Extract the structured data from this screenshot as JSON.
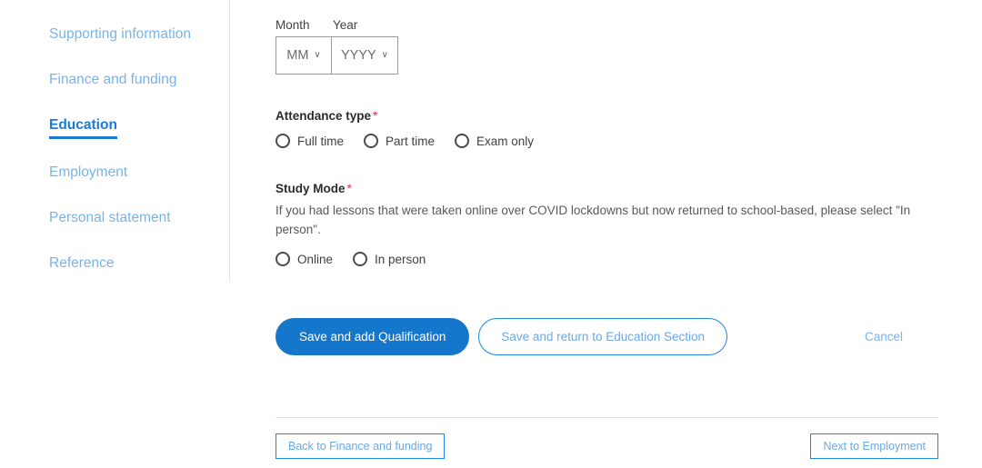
{
  "sidebar": {
    "items": [
      {
        "label": "Supporting information",
        "active": false
      },
      {
        "label": "Finance and funding",
        "active": false
      },
      {
        "label": "Education",
        "active": true
      },
      {
        "label": "Employment",
        "active": false
      },
      {
        "label": "Personal statement",
        "active": false
      },
      {
        "label": "Reference",
        "active": false
      }
    ]
  },
  "date": {
    "month_label": "Month",
    "year_label": "Year",
    "month_value": "MM",
    "year_value": "YYYY",
    "chevron": "∨"
  },
  "attendance": {
    "label": "Attendance type",
    "required_marker": "*",
    "options": [
      {
        "label": "Full time",
        "selected": false
      },
      {
        "label": "Part time",
        "selected": false
      },
      {
        "label": "Exam only",
        "selected": false
      }
    ]
  },
  "study_mode": {
    "label": "Study Mode",
    "required_marker": "*",
    "help": "If you had lessons that were taken online over COVID lockdowns but now returned to school-based, please select \"In person\".",
    "options": [
      {
        "label": "Online",
        "selected": false
      },
      {
        "label": "In person",
        "selected": false
      }
    ]
  },
  "actions": {
    "save_add": "Save and add Qualification",
    "save_return": "Save and return to Education Section",
    "cancel": "Cancel"
  },
  "bottom_nav": {
    "back": "Back to Finance and funding",
    "next": "Next to Employment"
  },
  "colors": {
    "primary": "#1577cc",
    "link": "#7ab3e8",
    "active_nav": "#1a7ad4",
    "required": "#e8294b",
    "border": "#1f86e0"
  }
}
